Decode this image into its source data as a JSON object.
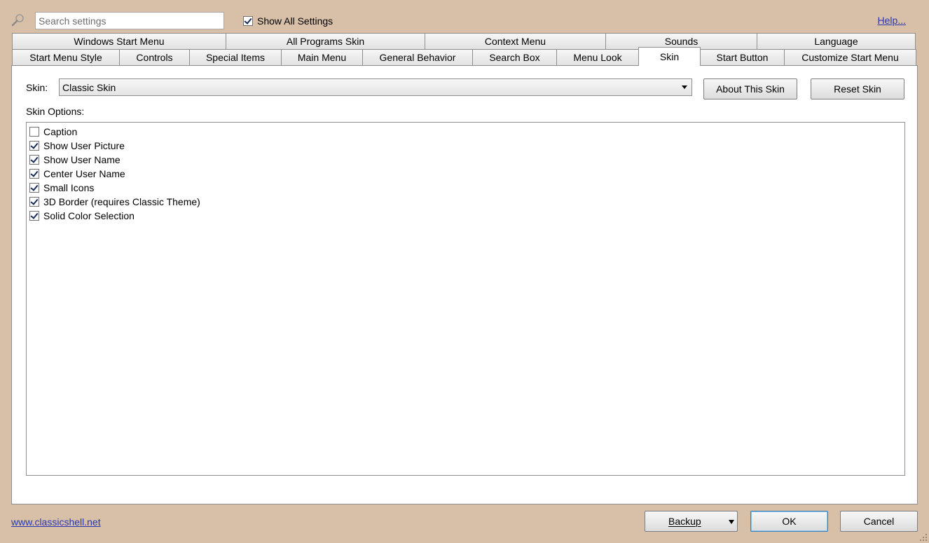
{
  "top": {
    "search_placeholder": "Search settings",
    "show_all_label": "Show All Settings",
    "show_all_checked": true,
    "help_label": "Help..."
  },
  "tabs": {
    "row1": [
      "Windows Start Menu",
      "All Programs Skin",
      "Context Menu",
      "Sounds",
      "Language"
    ],
    "row2": [
      "Start Menu Style",
      "Controls",
      "Special Items",
      "Main Menu",
      "General Behavior",
      "Search Box",
      "Menu Look",
      "Skin",
      "Start Button",
      "Customize Start Menu"
    ],
    "active": "Skin"
  },
  "skin": {
    "label": "Skin:",
    "selected": "Classic Skin",
    "about_button": "About This Skin",
    "reset_button": "Reset Skin",
    "options_label": "Skin Options:",
    "options": [
      {
        "label": "Caption",
        "checked": false
      },
      {
        "label": "Show User Picture",
        "checked": true
      },
      {
        "label": "Show User Name",
        "checked": true
      },
      {
        "label": "Center User Name",
        "checked": true
      },
      {
        "label": "Small Icons",
        "checked": true
      },
      {
        "label": "3D Border (requires Classic Theme)",
        "checked": true
      },
      {
        "label": "Solid Color Selection",
        "checked": true
      }
    ]
  },
  "footer": {
    "site_link": "www.classicshell.net",
    "backup_label": "Backup",
    "ok_label": "OK",
    "cancel_label": "Cancel"
  },
  "colors": {
    "background": "#d8bfa8",
    "link": "#2a36b0",
    "ok_border": "#3c7fb1"
  }
}
